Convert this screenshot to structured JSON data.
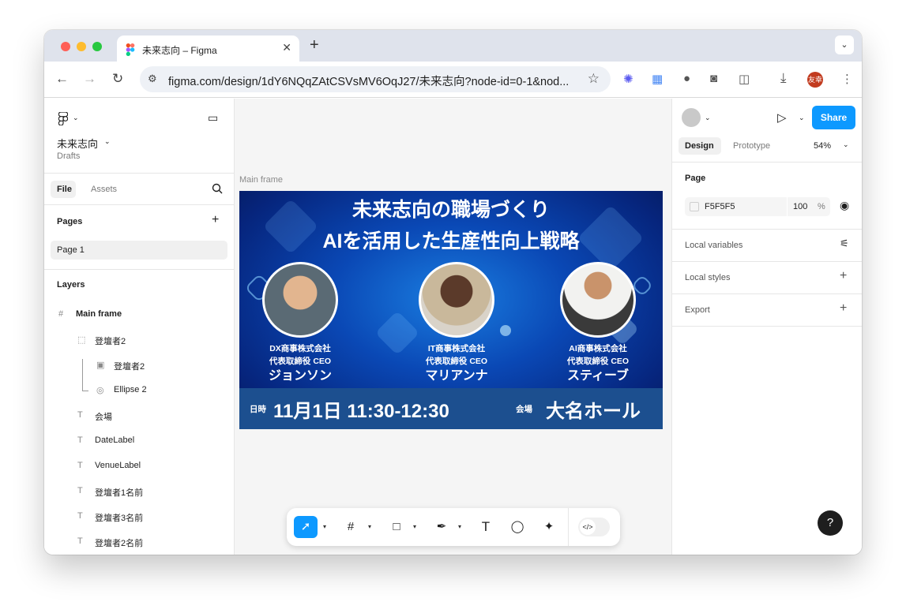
{
  "browser": {
    "tab_title": "未来志向 – Figma",
    "tab_close": "✕",
    "new_tab": "+",
    "url": "figma.com/design/1dY6NQqZAtCSVsMV6OqJ27/未来志向?node-id=0-1&nod...",
    "profile_initials": "友幸"
  },
  "left_panel": {
    "file_name": "未来志向",
    "file_location": "Drafts",
    "tabs": [
      "File",
      "Assets"
    ],
    "pages_header": "Pages",
    "pages": [
      "Page 1"
    ],
    "layers_header": "Layers",
    "layers": [
      {
        "name": "Main frame",
        "icon": "#",
        "indent": 0
      },
      {
        "name": "登壇者2",
        "icon": "⬚",
        "indent": 1
      },
      {
        "name": "登壇者2",
        "icon": "▣",
        "indent": 2
      },
      {
        "name": "Ellipse 2",
        "icon": "◎",
        "indent": 2
      },
      {
        "name": "会場",
        "icon": "T",
        "indent": 1
      },
      {
        "name": "DateLabel",
        "icon": "T",
        "indent": 1
      },
      {
        "name": "VenueLabel",
        "icon": "T",
        "indent": 1
      },
      {
        "name": "登壇者1名前",
        "icon": "T",
        "indent": 1
      },
      {
        "name": "登壇者3名前",
        "icon": "T",
        "indent": 1
      },
      {
        "name": "登壇者2名前",
        "icon": "T",
        "indent": 1
      }
    ]
  },
  "canvas": {
    "frame_label": "Main frame",
    "poster": {
      "title_line1": "未来志向の職場づくり",
      "title_line2": "AIを活用した生産性向上戦略",
      "speakers": [
        {
          "company": "DX商事株式会社",
          "role": "代表取締役 CEO",
          "name": "ジョンソン"
        },
        {
          "company": "IT商事株式会社",
          "role": "代表取締役 CEO",
          "name": "マリアンナ"
        },
        {
          "company": "AI商事株式会社",
          "role": "代表取締役 CEO",
          "name": "スティーブ"
        }
      ],
      "date_key": "日時",
      "date_value": "11月1日 11:30-12:30",
      "venue_key": "会場",
      "venue_value": "大名ホール"
    }
  },
  "right_panel": {
    "share_label": "Share",
    "tabs": [
      "Design",
      "Prototype"
    ],
    "zoom": "54%",
    "page_section": "Page",
    "page_color": "F5F5F5",
    "page_opacity": "100",
    "percent": "%",
    "local_variables": "Local variables",
    "local_styles": "Local styles",
    "export": "Export",
    "help": "?"
  },
  "colors": {
    "accent": "#0d99ff",
    "poster_dark": "#06257d",
    "info_bar": "#1c4f8f"
  }
}
